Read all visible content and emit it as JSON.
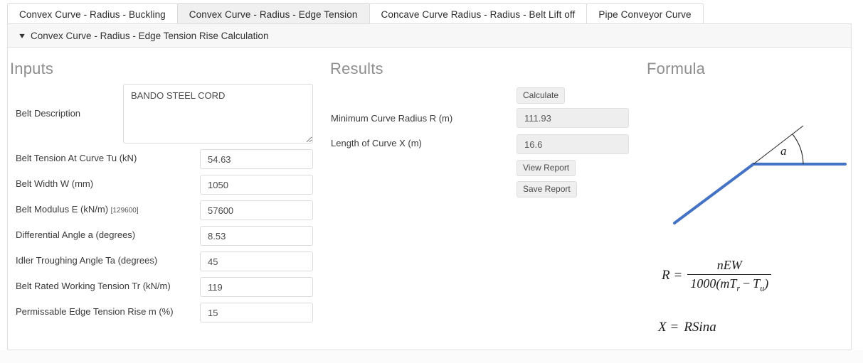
{
  "tabs": [
    {
      "label": "Convex Curve - Radius - Buckling",
      "active": false
    },
    {
      "label": "Convex Curve - Radius - Edge Tension",
      "active": true
    },
    {
      "label": "Concave Curve Radius - Radius - Belt Lift off",
      "active": false
    },
    {
      "label": "Pipe Conveyor Curve",
      "active": false
    }
  ],
  "panel": {
    "chevron_icon": "chevron-down-icon",
    "title": "Convex Curve - Radius - Edge Tension Rise Calculation"
  },
  "inputs": {
    "heading": "Inputs",
    "belt_description": {
      "label": "Belt Description",
      "value": "BANDO STEEL CORD"
    },
    "fields": [
      {
        "label": "Belt Tension At Curve Tu (kN)",
        "hint": "",
        "value": "54.63"
      },
      {
        "label": "Belt Width W (mm)",
        "hint": "",
        "value": "1050"
      },
      {
        "label": "Belt Modulus E (kN/m)",
        "hint": "[129600]",
        "value": "57600"
      },
      {
        "label": "Differential Angle a (degrees)",
        "hint": "",
        "value": "8.53"
      },
      {
        "label": "Idler Troughing Angle Ta (degrees)",
        "hint": "",
        "value": "45"
      },
      {
        "label": "Belt Rated Working Tension Tr (kN/m)",
        "hint": "",
        "value": "119"
      },
      {
        "label": "Permissable Edge Tension Rise m (%)",
        "hint": "",
        "value": "15"
      }
    ]
  },
  "results": {
    "heading": "Results",
    "calculate_label": "Calculate",
    "view_report_label": "View Report",
    "save_report_label": "Save Report",
    "fields": [
      {
        "label": "Minimum Curve Radius R (m)",
        "value": "111.93"
      },
      {
        "label": "Length of Curve X (m)",
        "value": "16.6"
      }
    ]
  },
  "formula": {
    "heading": "Formula",
    "diagram": {
      "angle_label": "a",
      "line_color": "#4472c4",
      "ray_color": "#262626"
    },
    "equation_main": {
      "lhs": "R",
      "equals": "=",
      "numerator": "nEW",
      "denominator_prefix": "1000(m",
      "denominator_sub1_base": "T",
      "denominator_sub1": "r",
      "denominator_op": "−",
      "denominator_sub2_base": "T",
      "denominator_sub2": "u",
      "denominator_suffix": ")"
    },
    "equation_secondary": {
      "lhs": "X",
      "equals": "=",
      "rhs": "RSina"
    }
  }
}
